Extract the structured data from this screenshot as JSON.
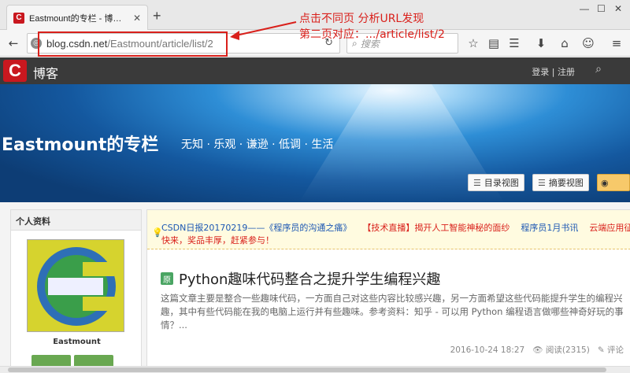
{
  "browser": {
    "tab_title": "Eastmount的专栏 - 博客…",
    "tab_favicon_letter": "C",
    "url_host": "blog.csdn.net",
    "url_path": "/Eastmount/article/list/2",
    "search_placeholder": "搜索",
    "window_controls": [
      "—",
      "☐",
      "✕"
    ]
  },
  "annotation": {
    "line1": "点击不同页 分析URL发现",
    "line2": "第二页对应：.../article/list/2",
    "color": "#d9201b"
  },
  "csdn": {
    "logo_letter": "C",
    "section": "博客",
    "login": "登录 | 注册"
  },
  "banner": {
    "blog_title": "Eastmount的专栏",
    "motto": "无知 · 乐观 · 谦逊 · 低调 · 生活",
    "catalog_view": "目录视图",
    "summary_view": "摘要视图"
  },
  "profile": {
    "heading": "个人资料",
    "name": "Eastmount"
  },
  "notice": {
    "item1": "CSDN日报20170219——《程序员的沟通之痛》",
    "item2": "【技术直播】揭开人工智能神秘的面纱",
    "item3": "程序员1月书讯",
    "item4": "云端应用征文大赛",
    "line2": "，奖品丰厚，赶紧参与！",
    "line2_lead": "快来"
  },
  "article": {
    "icon_label": "原",
    "title": "Python趣味代码整合之提升学生编程兴趣",
    "summary": "这篇文章主要是整合一些趣味代码，一方面自己对这些内容比较感兴趣，另一方面希望这些代码能提升学生的编程兴趣，其中有些代码能在我的电脑上运行并有些趣味。参考资料：知乎 - 可以用 Python 编程语言做哪些神奇好玩的事情？...",
    "date": "2016-10-24 18:27",
    "reads": "阅读(2315)",
    "comments": "评论"
  }
}
